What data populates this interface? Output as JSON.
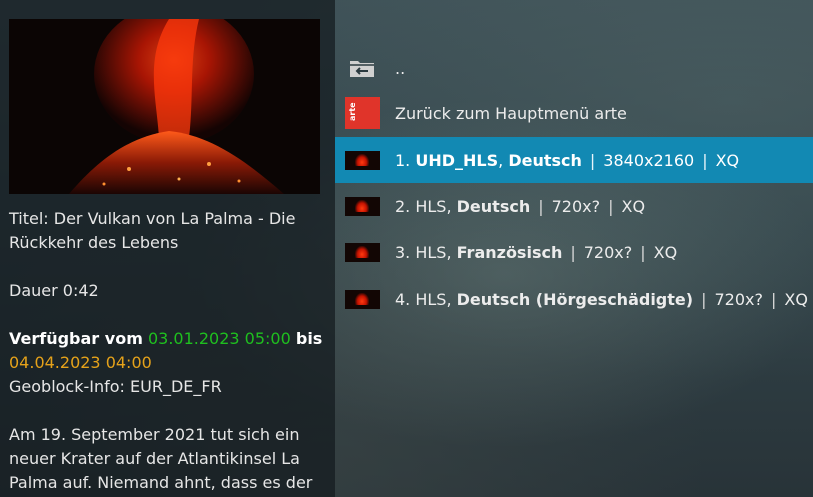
{
  "info": {
    "title_line": "Titel: Der Vulkan von La Palma - Die Rückkehr des Lebens",
    "duration": "Dauer 0:42",
    "avail_prefix": "Verfügbar vom",
    "avail_from": "03.01.2023 05:00",
    "avail_mid": "bis",
    "avail_to": "04.04.2023 04:00",
    "geoblock": "Geoblock-Info: EUR_DE_FR",
    "description": "Am 19. September 2021 tut sich ein neuer Krater auf der Atlantikinsel La Palma auf. Niemand ahnt, dass es der"
  },
  "list": {
    "parent_label": "..",
    "back_label": "Zurück zum Hauptmenü arte",
    "arte_logo_text": "arte",
    "items": [
      {
        "num": "1. ",
        "format": "UHD_HLS",
        "lang": "Deutsch",
        "res": "3840x2160",
        "quality": "XQ"
      },
      {
        "num": "2. ",
        "format": "HLS",
        "lang": "Deutsch",
        "res": "720x?",
        "quality": "XQ"
      },
      {
        "num": "3. ",
        "format": "HLS",
        "lang": "Französisch",
        "res": "720x?",
        "quality": "XQ"
      },
      {
        "num": "4. ",
        "format": "HLS",
        "lang": "Deutsch (Hörgeschädigte)",
        "res": "720x?",
        "quality": "XQ"
      }
    ]
  },
  "colors": {
    "selected": "#1289b3",
    "green": "#1fbf1f",
    "orange": "#e5a21a"
  }
}
